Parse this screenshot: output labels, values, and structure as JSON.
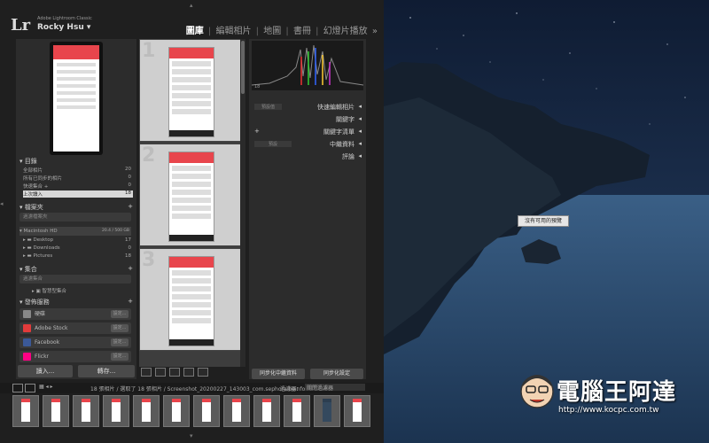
{
  "header": {
    "app_name": "Adobe Lightroom Classic",
    "user_name": "Rocky Hsu",
    "logo": "Lr",
    "modules": [
      "圖庫",
      "編輯相片",
      "地圖",
      "書冊",
      "幻燈片播放"
    ],
    "active_module": "圖庫",
    "more": "»"
  },
  "catalog": {
    "title": "目錄",
    "items": [
      {
        "label": "全部相片",
        "count": "20"
      },
      {
        "label": "所有已同步的相片",
        "count": "0"
      },
      {
        "label": "快速集合 +",
        "count": "0"
      },
      {
        "label": "上次讀入",
        "count": "18"
      }
    ]
  },
  "folders": {
    "title": "檔案夾",
    "search_placeholder": "過濾檔案夾",
    "volume": {
      "label": "Macintosh HD",
      "info": "20.4 / 500 GB"
    },
    "items": [
      {
        "label": "Desktop",
        "count": "17"
      },
      {
        "label": "Downloads",
        "count": "0"
      },
      {
        "label": "Pictures",
        "count": "18"
      }
    ]
  },
  "collections": {
    "title": "集合",
    "search_placeholder": "過濾集合",
    "items": [
      {
        "label": "智慧型集合"
      }
    ]
  },
  "publish": {
    "title": "發佈服務",
    "items": [
      {
        "label": "硬碟",
        "button": "設定...",
        "color": "#888888"
      },
      {
        "label": "Adobe Stock",
        "button": "設定...",
        "color": "#e23b3b"
      },
      {
        "label": "Facebook",
        "button": "設定...",
        "color": "#3b5998"
      },
      {
        "label": "Flickr",
        "button": "設定...",
        "color": "#ff0084"
      }
    ]
  },
  "bottom_buttons": {
    "import": "讀入...",
    "export": "轉存..."
  },
  "grid": {
    "cells": [
      "1",
      "2",
      "3"
    ]
  },
  "right_panel": {
    "sections": [
      {
        "label": "快速編輯相片",
        "value": "預設值"
      },
      {
        "label": "關鍵字"
      },
      {
        "label": "關鍵字清單"
      },
      {
        "label": "中繼資料",
        "value": "預設"
      },
      {
        "label": "評論"
      }
    ],
    "histogram_info": "18",
    "sync_metadata": "同步化中繼資料",
    "sync_settings": "同步化設定"
  },
  "filmstrip": {
    "info": "18 張相片 / 選取了 18 張相片 / Screenshot_20200227_143003_com.sephora.beinfo",
    "filter_label": "過濾器：",
    "filter_value": "關閉過濾器",
    "thumb_count": 12
  },
  "desktop": {
    "notice": "沒有可用的預覽"
  },
  "watermark": {
    "title": "電腦王阿達",
    "url": "http://www.kocpc.com.tw"
  }
}
